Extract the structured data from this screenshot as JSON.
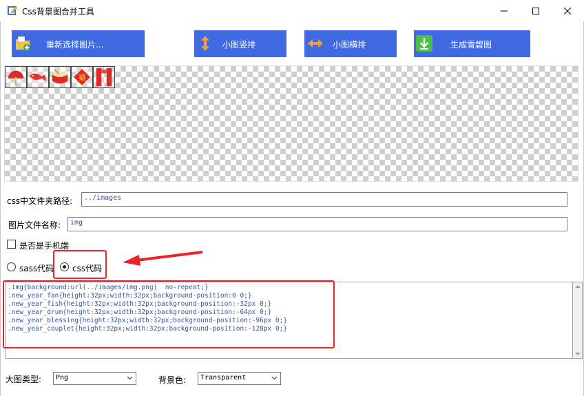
{
  "window": {
    "title": "Css背景图合并工具",
    "icon": "pencil-app-icon"
  },
  "toolbar": {
    "reselect_label": "重新选择图片...",
    "vertical_label": "小图竖排",
    "horizontal_label": "小图横排",
    "generate_label": "生成雪碧图"
  },
  "preview": {
    "tiles": [
      "fan",
      "fish",
      "drum",
      "blessing",
      "couplet"
    ]
  },
  "form": {
    "css_path_label": "css中文件夹路径:",
    "css_path_value": "../images",
    "image_name_label": "图片文件名称:",
    "image_name_value": "img",
    "mobile_label": "是否是手机端",
    "mobile_checked": false,
    "sass_label": "sass代码",
    "css_label": "css代码",
    "selected_mode": "css"
  },
  "code_lines": [
    ".img{background:url(../images/img.png)  no-repeat;}",
    ".new_year_fan{height:32px;width:32px;background-position:0 0;}",
    ".new_year_fish{height:32px;width:32px;background-position:-32px 0;}",
    ".new_year_drum{height:32px;width:32px;background-position:-64px 0;}",
    ".new_year_blessing{height:32px;width:32px;background-position:-96px 0;}",
    ".new_year_couplet{height:32px;width:32px;background-position:-128px 0;}"
  ],
  "footer": {
    "image_type_label": "大图类型:",
    "image_type_value": "Png",
    "bg_color_label": "背景色:",
    "bg_color_value": "Transparent"
  },
  "colors": {
    "button_blue": "#4169e1",
    "highlight_red": "#e8242a"
  }
}
